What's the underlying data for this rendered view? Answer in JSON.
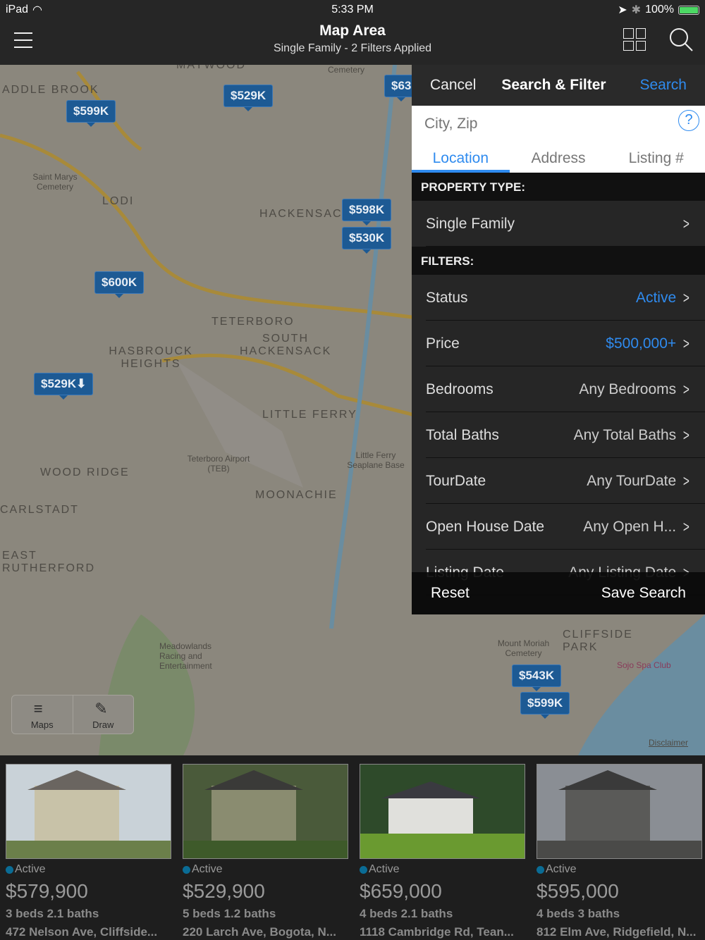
{
  "status_bar": {
    "device": "iPad",
    "time": "5:33 PM",
    "battery": "100%"
  },
  "nav": {
    "title": "Map Area",
    "subtitle": "Single Family - 2 Filters Applied"
  },
  "map": {
    "pins": [
      "$599K",
      "$529K",
      "$63",
      "$598K",
      "$530K",
      "$600K",
      "$529K⬇",
      "$543K",
      "$599K"
    ],
    "labels": [
      "ADDLE BROOK",
      "MAYWOOD",
      "Cemetery",
      "LODI",
      "HACKENSAC",
      "TETERBORO",
      "SOUTH HACKENSACK",
      "HASBROUCK HEIGHTS",
      "LITTLE FERRY",
      "WOOD RIDGE",
      "CARLSTADT",
      "EAST RUTHERFORD",
      "MOONACHIE",
      "CLIFFSIDE PARK",
      "Saint Marys Cemetery",
      "Teterboro Airport (TEB)",
      "Little Ferry Seaplane Base",
      "Meadowlands Racing and Entertainment",
      "Mount Moriah Cemetery",
      "Sojo Spa Club",
      "Disclaimer"
    ],
    "controls": {
      "maps": "Maps",
      "draw": "Draw"
    }
  },
  "panel": {
    "cancel": "Cancel",
    "title": "Search & Filter",
    "search": "Search",
    "search_placeholder": "City, Zip",
    "tabs": [
      "Location",
      "Address",
      "Listing #"
    ],
    "property_type_header": "PROPERTY TYPE:",
    "property_type": "Single Family",
    "filters_header": "FILTERS:",
    "filters": [
      {
        "label": "Status",
        "value": "Active"
      },
      {
        "label": "Price",
        "value": "$500,000+"
      },
      {
        "label": "Bedrooms",
        "value": "Any Bedrooms"
      },
      {
        "label": "Total Baths",
        "value": "Any Total Baths"
      },
      {
        "label": "TourDate",
        "value": "Any TourDate"
      },
      {
        "label": "Open House Date",
        "value": "Any Open H..."
      },
      {
        "label": "Listing Date",
        "value": "Any Listing Date"
      }
    ],
    "reset": "Reset",
    "save_search": "Save Search"
  },
  "listings": [
    {
      "status": "Active",
      "price": "$579,900",
      "beds_baths": "3 beds 2.1 baths",
      "address": "472 Nelson Ave, Cliffside..."
    },
    {
      "status": "Active",
      "price": "$529,900",
      "beds_baths": "5 beds 1.2 baths",
      "address": "220 Larch Ave, Bogota, N..."
    },
    {
      "status": "Active",
      "price": "$659,000",
      "beds_baths": "4 beds 2.1 baths",
      "address": "1118 Cambridge Rd, Tean..."
    },
    {
      "status": "Active",
      "price": "$595,000",
      "beds_baths": "4 beds 3 baths",
      "address": "812 Elm Ave, Ridgefield, N..."
    }
  ],
  "colors": {
    "accent": "#2f8bef",
    "pin": "#1d5a94",
    "status_dot": "#0a6c95"
  }
}
